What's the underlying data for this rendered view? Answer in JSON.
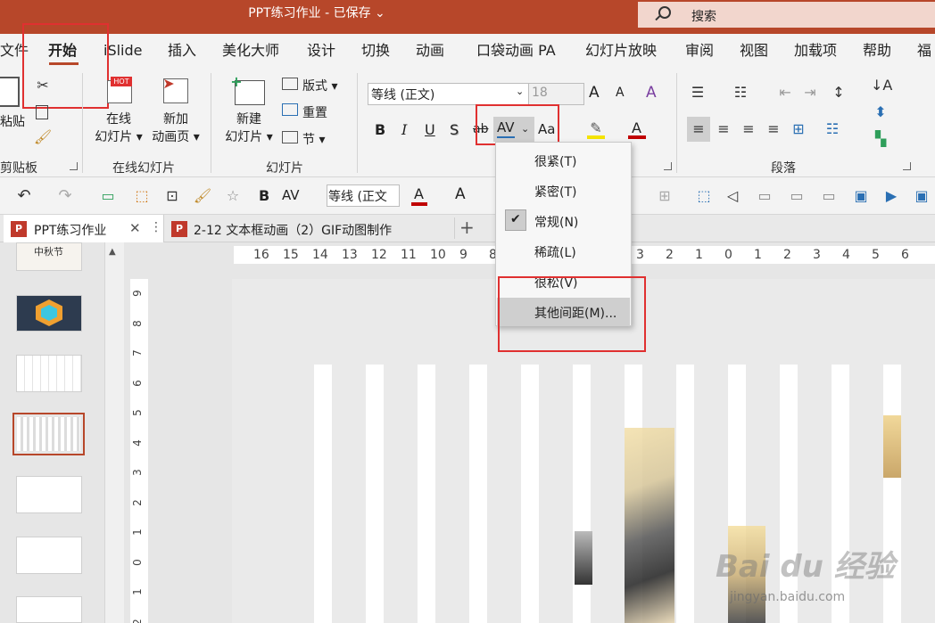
{
  "window": {
    "title": "PPT练习作业 - 已保存 ⌄",
    "search": "搜索"
  },
  "ribbon_tabs": [
    "文件",
    "开始",
    "iSlide",
    "插入",
    "美化大师",
    "设计",
    "切换",
    "动画",
    "口袋动画 PA",
    "幻灯片放映",
    "审阅",
    "视图",
    "加载项",
    "帮助",
    "福"
  ],
  "groups": {
    "clipboard": {
      "label": "剪贴板",
      "paste": "粘贴"
    },
    "online": {
      "label": "在线幻灯片",
      "online_btn_1": "在线",
      "online_btn_2": "幻灯片 ▾",
      "new_btn_1": "新加",
      "new_btn_2": "动画页 ▾",
      "hot_badge": "HOT"
    },
    "slides": {
      "label": "幻灯片",
      "new_1": "新建",
      "new_2": "幻灯片 ▾",
      "layout": "版式 ▾",
      "reset": "重置",
      "section": "节 ▾"
    },
    "font": {
      "font_name": "等线 (正文)",
      "font_size": "18",
      "bold": "B",
      "italic": "I",
      "underline": "U",
      "shadow": "S",
      "strike": "ab",
      "spacing": "AV",
      "case": "Aa",
      "grow": "A",
      "shrink": "A",
      "clear": "A",
      "color_a": "A"
    },
    "paragraph": {
      "label": "段落"
    }
  },
  "qat": {
    "font_name": "等线 (正文)",
    "bold": "B",
    "spacing": "AV",
    "color_a": "A",
    "grow": "A"
  },
  "doc_tabs": [
    {
      "label": "PPT练习作业",
      "close": "✕",
      "more": "⋮"
    },
    {
      "label": "2-12 文本框动画（2）GIF动图制作"
    }
  ],
  "add_tab": "+",
  "hruler_numbers": [
    "16",
    "15",
    "14",
    "13",
    "12",
    "11",
    "10",
    "9",
    "8",
    "7",
    "6",
    "5",
    "4",
    "3",
    "2",
    "1",
    "0",
    "1",
    "2",
    "3",
    "4",
    "5",
    "6"
  ],
  "vruler_numbers": [
    "9",
    "8",
    "7",
    "6",
    "5",
    "4",
    "3",
    "2",
    "1",
    "0",
    "1",
    "2"
  ],
  "thumbnail_title_text": "中秋节",
  "spacing_menu": {
    "items": [
      "很紧(T)",
      "紧密(T)",
      "常规(N)",
      "稀疏(L)",
      "很松(V)",
      "其他间距(M)..."
    ],
    "checked_index": 2,
    "hovered_index": 5
  },
  "watermark": {
    "brand": "Bai du 经验",
    "url": "jingyan.baidu.com"
  },
  "colors": {
    "accent": "#b7472a",
    "highlight": "#e03030",
    "ribbon": "#f3f3f3"
  }
}
